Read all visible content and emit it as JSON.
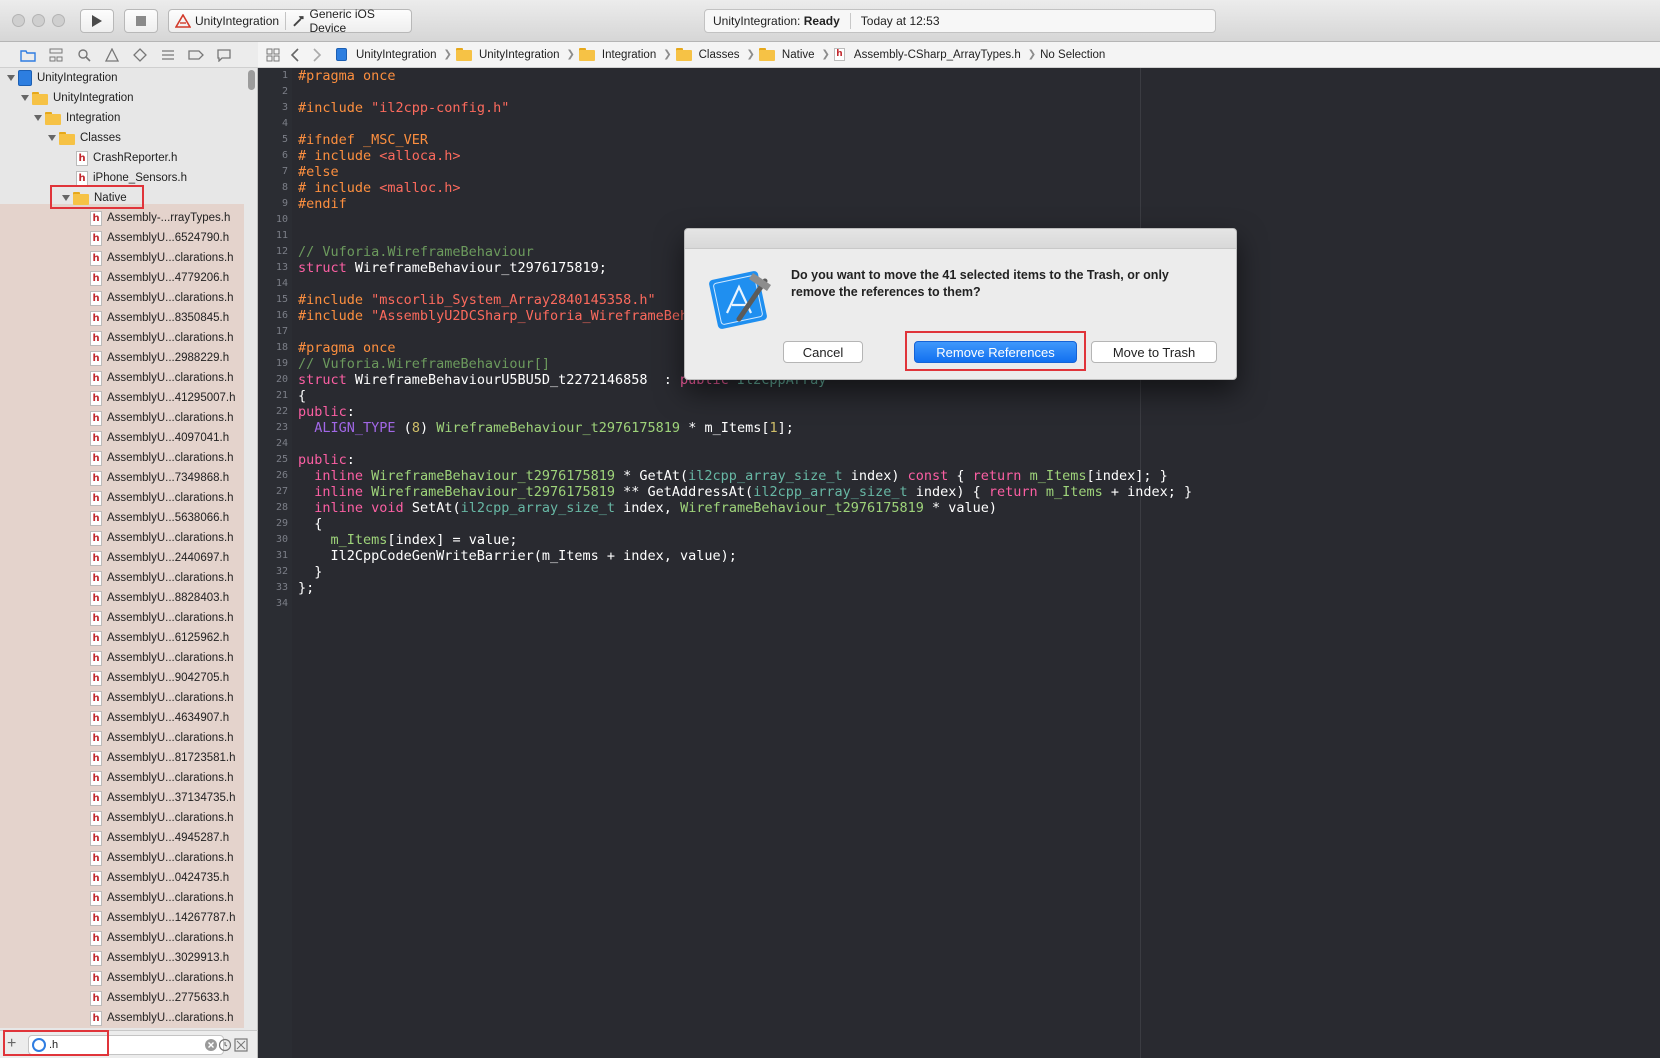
{
  "toolbar": {
    "scheme_project": "UnityIntegration",
    "scheme_device": "Generic iOS Device",
    "status_project": "UnityIntegration:",
    "status_state": "Ready",
    "status_time": "Today at 12:53"
  },
  "jumpbar": {
    "crumbs": [
      "UnityIntegration",
      "UnityIntegration",
      "Integration",
      "Classes",
      "Native",
      "Assembly-CSharp_ArrayTypes.h"
    ],
    "tail": "No Selection"
  },
  "tree": {
    "root": "UnityIntegration",
    "group": "UnityIntegration",
    "integration": "Integration",
    "classes": "Classes",
    "file_crash": "CrashReporter.h",
    "file_sensors": "iPhone_Sensors.h",
    "native": "Native",
    "files": [
      "Assembly-...rrayTypes.h",
      "AssemblyU...6524790.h",
      "AssemblyU...clarations.h",
      "AssemblyU...4779206.h",
      "AssemblyU...clarations.h",
      "AssemblyU...8350845.h",
      "AssemblyU...clarations.h",
      "AssemblyU...2988229.h",
      "AssemblyU...clarations.h",
      "AssemblyU...41295007.h",
      "AssemblyU...clarations.h",
      "AssemblyU...4097041.h",
      "AssemblyU...clarations.h",
      "AssemblyU...7349868.h",
      "AssemblyU...clarations.h",
      "AssemblyU...5638066.h",
      "AssemblyU...clarations.h",
      "AssemblyU...2440697.h",
      "AssemblyU...clarations.h",
      "AssemblyU...8828403.h",
      "AssemblyU...clarations.h",
      "AssemblyU...6125962.h",
      "AssemblyU...clarations.h",
      "AssemblyU...9042705.h",
      "AssemblyU...clarations.h",
      "AssemblyU...4634907.h",
      "AssemblyU...clarations.h",
      "AssemblyU...81723581.h",
      "AssemblyU...clarations.h",
      "AssemblyU...37134735.h",
      "AssemblyU...clarations.h",
      "AssemblyU...4945287.h",
      "AssemblyU...clarations.h",
      "AssemblyU...0424735.h",
      "AssemblyU...clarations.h",
      "AssemblyU...14267787.h",
      "AssemblyU...clarations.h",
      "AssemblyU...3029913.h",
      "AssemblyU...clarations.h",
      "AssemblyU...2775633.h",
      "AssemblyU...clarations.h"
    ]
  },
  "filter": {
    "value": ".h"
  },
  "dialog": {
    "message": "Do you want to move the 41 selected items to the Trash, or only remove the references to them?",
    "cancel": "Cancel",
    "remove": "Remove References",
    "trash": "Move to Trash"
  },
  "code": [
    [
      [
        "pp",
        "#pragma once"
      ]
    ],
    [],
    [
      [
        "pp",
        "#include "
      ],
      [
        "str",
        "\"il2cpp-config.h\""
      ]
    ],
    [],
    [
      [
        "pp",
        "#ifndef _MSC_VER"
      ]
    ],
    [
      [
        "pp",
        "# include "
      ],
      [
        "str",
        "<alloca.h>"
      ]
    ],
    [
      [
        "pp",
        "#else"
      ]
    ],
    [
      [
        "pp",
        "# include "
      ],
      [
        "str",
        "<malloc.h>"
      ]
    ],
    [
      [
        "pp",
        "#endif"
      ]
    ],
    [],
    [],
    [
      [
        "cm2",
        "// Vuforia.WireframeBehaviour"
      ]
    ],
    [
      [
        "k",
        "struct "
      ],
      [
        "t",
        "WireframeBehaviour_t2976175819;"
      ]
    ],
    [],
    [
      [
        "pp",
        "#include "
      ],
      [
        "str",
        "\"mscorlib_System_Array2840145358.h\""
      ]
    ],
    [
      [
        "pp",
        "#include "
      ],
      [
        "str",
        "\"AssemblyU2DCSharp_Vuforia_WireframeBehaviour_t2976175819.h\""
      ]
    ],
    [],
    [
      [
        "pp",
        "#pragma once"
      ]
    ],
    [
      [
        "cm2",
        "// Vuforia.WireframeBehaviour[]"
      ]
    ],
    [
      [
        "k",
        "struct "
      ],
      [
        "t",
        "WireframeBehaviourU5BU5D_t2272146858  : "
      ],
      [
        "k",
        "public "
      ],
      [
        "ty",
        "Il2CppArray"
      ]
    ],
    [
      [
        "t",
        "{"
      ]
    ],
    [
      [
        "k",
        "public"
      ],
      [
        "t",
        ":"
      ]
    ],
    [
      [
        "t",
        "  "
      ],
      [
        "fn",
        "ALIGN_TYPE"
      ],
      [
        "t",
        " ("
      ],
      [
        "num",
        "8"
      ],
      [
        "t",
        ") "
      ],
      [
        "tyg",
        "WireframeBehaviour_t2976175819"
      ],
      [
        "t",
        " * m_Items["
      ],
      [
        "num",
        "1"
      ],
      [
        "t",
        "];"
      ]
    ],
    [],
    [
      [
        "k",
        "public"
      ],
      [
        "t",
        ":"
      ]
    ],
    [
      [
        "t",
        "  "
      ],
      [
        "k",
        "inline "
      ],
      [
        "tyg",
        "WireframeBehaviour_t2976175819"
      ],
      [
        "t",
        " * GetAt("
      ],
      [
        "ty",
        "il2cpp_array_size_t"
      ],
      [
        "t",
        " index) "
      ],
      [
        "k",
        "const"
      ],
      [
        "t",
        " { "
      ],
      [
        "k",
        "return "
      ],
      [
        "tyg",
        "m_Items"
      ],
      [
        "t",
        "[index]; }"
      ]
    ],
    [
      [
        "t",
        "  "
      ],
      [
        "k",
        "inline "
      ],
      [
        "tyg",
        "WireframeBehaviour_t2976175819"
      ],
      [
        "t",
        " ** GetAddressAt("
      ],
      [
        "ty",
        "il2cpp_array_size_t"
      ],
      [
        "t",
        " index) { "
      ],
      [
        "k",
        "return "
      ],
      [
        "tyg",
        "m_Items"
      ],
      [
        "t",
        " + index; }"
      ]
    ],
    [
      [
        "t",
        "  "
      ],
      [
        "k",
        "inline void "
      ],
      [
        "t",
        "SetAt("
      ],
      [
        "ty",
        "il2cpp_array_size_t"
      ],
      [
        "t",
        " index, "
      ],
      [
        "tyg",
        "WireframeBehaviour_t2976175819"
      ],
      [
        "t",
        " * value)"
      ]
    ],
    [
      [
        "t",
        "  {"
      ]
    ],
    [
      [
        "t",
        "    "
      ],
      [
        "tyg",
        "m_Items"
      ],
      [
        "t",
        "[index] = value;"
      ]
    ],
    [
      [
        "t",
        "    Il2CppCodeGenWriteBarrier(m_Items + index, value);"
      ]
    ],
    [
      [
        "t",
        "  }"
      ]
    ],
    [
      [
        "t",
        "};"
      ]
    ],
    []
  ],
  "colors": {
    "editor_bg": "#292a30",
    "keyword": "#fc5fa3",
    "preproc": "#fd8f3f",
    "string": "#fc6a5d",
    "accent": "#1270f0",
    "highlight_box": "#e0343a"
  }
}
